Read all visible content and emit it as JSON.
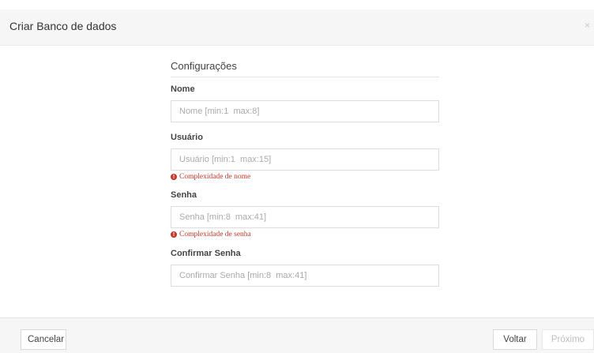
{
  "modal": {
    "title": "Criar Banco de dados",
    "close_label": "×"
  },
  "form": {
    "section_title": "Configurações",
    "fields": [
      {
        "label": "Nome",
        "placeholder": "Nome [min:1  max:8]",
        "value": "",
        "error": ""
      },
      {
        "label": "Usuário",
        "placeholder": "Usuário [min:1  max:15]",
        "value": "",
        "error": "Complexidade de nome"
      },
      {
        "label": "Senha",
        "placeholder": "Senha [min:8  max:41]",
        "value": "",
        "error": "Complexidade de senha"
      },
      {
        "label": "Confirmar Senha",
        "placeholder": "Confirmar Senha [min:8  max:41]",
        "value": "",
        "error": ""
      }
    ]
  },
  "footer": {
    "cancel_label": "Cancelar",
    "back_label": "Voltar",
    "next_label": "Próximo"
  },
  "colors": {
    "error": "#c0392b",
    "header_bg": "#f6f6f6",
    "disabled_text": "#bdbdbd"
  }
}
